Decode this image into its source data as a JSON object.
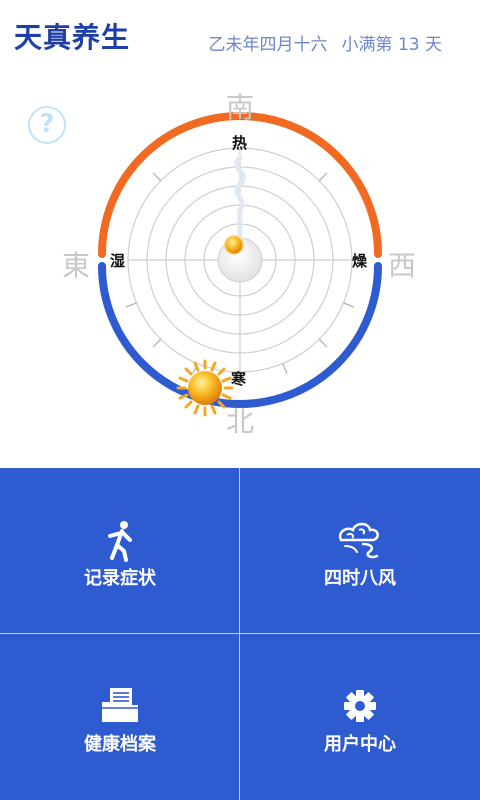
{
  "header": {
    "title": "天真养生",
    "lunar_date": "乙未年四月十六",
    "solar_term": "小满第 13 天"
  },
  "help": {
    "icon": "question-icon",
    "glyph": "?"
  },
  "dial": {
    "directions": {
      "south": "南",
      "north": "北",
      "east": "東",
      "west": "西"
    },
    "qualities": {
      "top": "热",
      "right": "燥",
      "left": "湿",
      "bottom": "寒"
    },
    "colors": {
      "warm_arc": "#f06a22",
      "cool_arc": "#2f5bd1",
      "sun": "#f5a623"
    }
  },
  "menu": [
    {
      "label": "记录症状",
      "icon": "person-walking-icon"
    },
    {
      "label": "四时八风",
      "icon": "wind-cloud-icon"
    },
    {
      "label": "健康档案",
      "icon": "folder-document-icon"
    },
    {
      "label": "用户中心",
      "icon": "gear-icon"
    }
  ],
  "theme": {
    "primary": "#2f5bd1",
    "title_color": "#1f3fa8"
  }
}
